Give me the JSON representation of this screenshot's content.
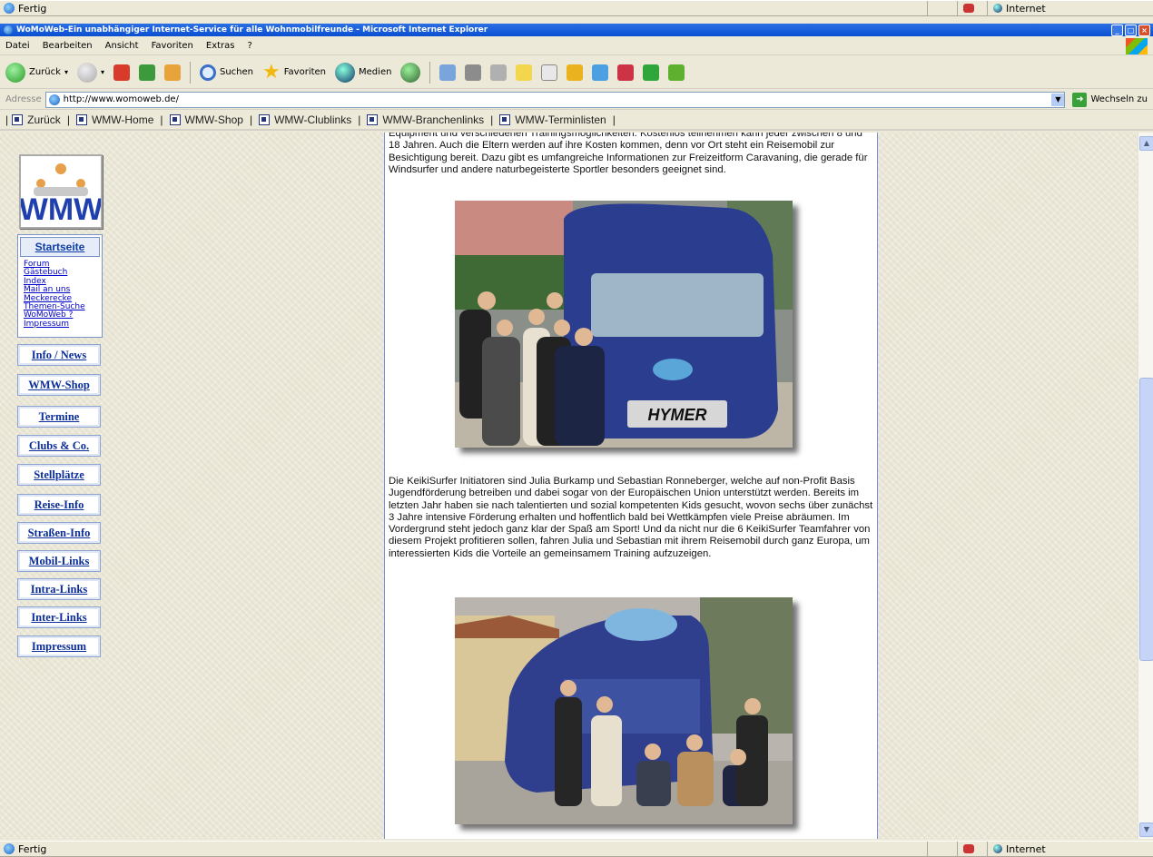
{
  "browser": {
    "title": "WoMoWeb-Ein unabhängiger Internet-Service für alle Wohnmobilfreunde - Microsoft Internet Explorer",
    "menu": [
      "Datei",
      "Bearbeiten",
      "Ansicht",
      "Favoriten",
      "Extras",
      "?"
    ],
    "toolbar": {
      "back": "Zurück",
      "search": "Suchen",
      "favorites": "Favoriten",
      "media": "Medien"
    },
    "address_label": "Adresse",
    "url": "http://www.womoweb.de/",
    "go_label": "Wechseln zu",
    "status_left": "Fertig",
    "status_zone": "Internet"
  },
  "links_bar": [
    "Zurück",
    "WMW-Home",
    "WMW-Shop",
    "WMW-Clublinks",
    "WMW-Branchenlinks",
    "WMW-Terminlisten"
  ],
  "nav": {
    "start": "Startseite",
    "sublinks": [
      "Forum",
      "Gästebuch",
      "Index",
      "Mail an uns",
      "Meckerecke",
      "Themen-Suche",
      "WoMoWeb ?",
      "Impressum"
    ],
    "buttons": [
      "Info / News",
      "WMW-Shop",
      "Termine",
      "Clubs & Co.",
      "Stellplätze",
      "Reise-Info",
      "Straßen-Info",
      "Mobil-Links",
      "Intra-Links",
      "Inter-Links",
      "Impressum"
    ]
  },
  "logo": {
    "letters": "WMW"
  },
  "content": {
    "para1": "Equipment und verschiedenen Trainingsmöglichkeiten. Kostenlos teilnehmen kann jeder zwischen 8 und 18 Jahren. Auch die Eltern werden auf ihre Kosten kommen, denn vor Ort steht ein Reisemobil zur Besichtigung bereit. Dazu gibt es umfangreiche Informationen zur Freizeitform Caravaning, die gerade für Windsurfer und andere naturbegeisterte Sportler besonders geeignet sind.",
    "para2": "Die KeikiSurfer Initiatoren sind Julia Burkamp und Sebastian Ronneberger, welche auf non-Profit Basis Jugendförderung betreiben und dabei sogar von der Europäischen Union unterstützt werden. Bereits im letzten Jahr haben sie nach talentierten und sozial kompetenten Kids gesucht, wovon sechs über zunächst 3 Jahre intensive Förderung erhalten und hoffentlich bald bei Wettkämpfen viele Preise abräumen. Im Vordergrund steht jedoch ganz klar der Spaß am Sport! Und da nicht nur die 6 KeikiSurfer Teamfahrer von diesem Projekt profitieren sollen, fahren Julia und Sebastian mit ihrem Reisemobil durch ganz Europa, um interessierten Kids die Vorteile an gemeinsamem Training aufzuzeigen.",
    "photo1_text": "HYMER"
  }
}
